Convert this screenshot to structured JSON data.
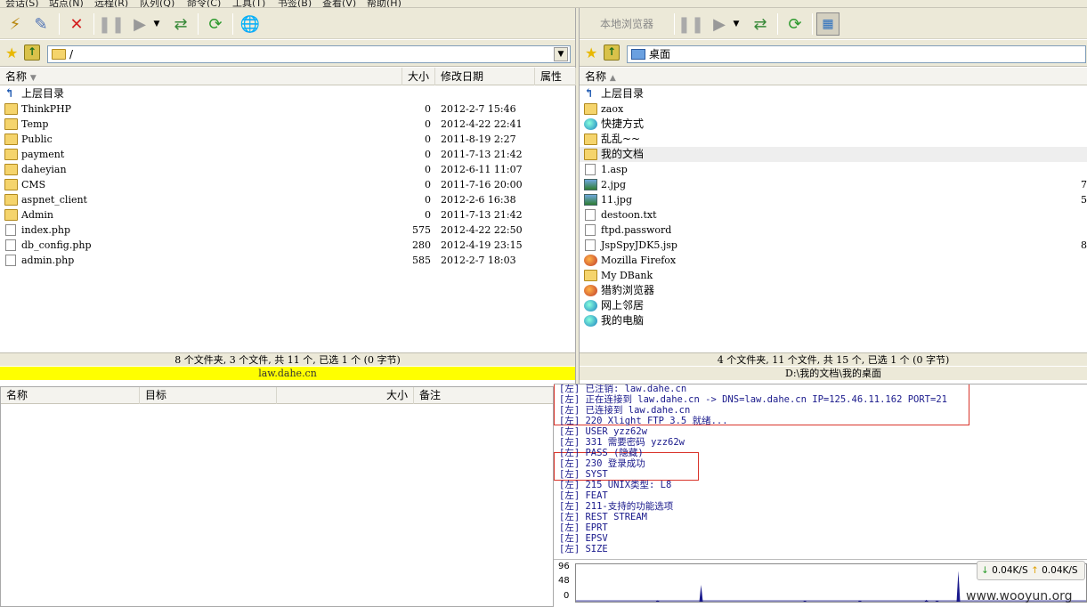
{
  "menu": {
    "items": [
      "会话(S)",
      "站点(N)",
      "远程(R)",
      "队列(Q)",
      "命令(C)",
      "工具(T)",
      "书签(B)",
      "查看(V)",
      "帮助(H)"
    ]
  },
  "left": {
    "address": "/",
    "columns": {
      "name": "名称",
      "size": "大小",
      "date": "修改日期",
      "attr": "属性"
    },
    "parent": "上层目录",
    "files": [
      {
        "name": "ThinkPHP",
        "size": "0",
        "date": "2012-2-7 15:46",
        "icon": "folder-icon"
      },
      {
        "name": "Temp",
        "size": "0",
        "date": "2012-4-22 22:41",
        "icon": "folder-icon"
      },
      {
        "name": "Public",
        "size": "0",
        "date": "2011-8-19 2:27",
        "icon": "folder-icon"
      },
      {
        "name": "payment",
        "size": "0",
        "date": "2011-7-13 21:42",
        "icon": "folder-icon"
      },
      {
        "name": "daheyian",
        "size": "0",
        "date": "2012-6-11 11:07",
        "icon": "folder-icon"
      },
      {
        "name": "CMS",
        "size": "0",
        "date": "2011-7-16 20:00",
        "icon": "folder-icon"
      },
      {
        "name": "aspnet_client",
        "size": "0",
        "date": "2012-2-6 16:38",
        "icon": "folder-icon"
      },
      {
        "name": "Admin",
        "size": "0",
        "date": "2011-7-13 21:42",
        "icon": "folder-icon"
      },
      {
        "name": "index.php",
        "size": "575",
        "date": "2012-4-22 22:50",
        "icon": "php-file-icon"
      },
      {
        "name": "db_config.php",
        "size": "280",
        "date": "2012-4-19 23:15",
        "icon": "php-file-icon"
      },
      {
        "name": "admin.php",
        "size": "585",
        "date": "2012-2-7 18:03",
        "icon": "php-file-icon"
      }
    ],
    "status": "8 个文件夹, 3 个文件, 共 11 个, 已选 1 个 (0 字节)",
    "host": "law.dahe.cn"
  },
  "right": {
    "browser_label": "本地浏览器",
    "address": "桌面",
    "columns": {
      "name": "名称"
    },
    "parent": "上层目录",
    "files": [
      {
        "name": "zaox",
        "icon": "folder-icon",
        "size": ""
      },
      {
        "name": "快捷方式",
        "icon": "web-icon",
        "size": ""
      },
      {
        "name": "乱乱~~",
        "icon": "folder-icon",
        "size": ""
      },
      {
        "name": "我的文档",
        "icon": "folder-icon",
        "size": ""
      },
      {
        "name": "1.asp",
        "icon": "file-icon",
        "size": ""
      },
      {
        "name": "2.jpg",
        "icon": "image-icon",
        "size": "7"
      },
      {
        "name": "11.jpg",
        "icon": "image-icon",
        "size": "5"
      },
      {
        "name": "destoon.txt",
        "icon": "text-file-icon",
        "size": ""
      },
      {
        "name": "ftpd.password",
        "icon": "file-icon",
        "size": ""
      },
      {
        "name": "JspSpyJDK5.jsp",
        "icon": "file-icon",
        "size": "8"
      },
      {
        "name": "Mozilla Firefox",
        "icon": "firefox-icon",
        "size": ""
      },
      {
        "name": "My DBank",
        "icon": "folder-icon",
        "size": ""
      },
      {
        "name": "猎豹浏览器",
        "icon": "browser-icon",
        "size": ""
      },
      {
        "name": "网上邻居",
        "icon": "network-icon",
        "size": ""
      },
      {
        "name": "我的电脑",
        "icon": "computer-icon",
        "size": ""
      }
    ],
    "status": "4 个文件夹, 11 个文件, 共 15 个, 已选 1 个 (0 字节)",
    "path": "D:\\我的文档\\我的桌面"
  },
  "queue": {
    "columns": {
      "name": "名称",
      "target": "目标",
      "size": "大小",
      "note": "备注"
    }
  },
  "log": [
    "[左] 已注销: law.dahe.cn",
    "[左] 正在连接到 law.dahe.cn -> DNS=law.dahe.cn IP=125.46.11.162 PORT=21",
    "[左] 已连接到 law.dahe.cn",
    "[左] 220 Xlight FTP 3.5 就绪...",
    "[左] USER yzz62w",
    "[左] 331 需要密码 yzz62w",
    "[左] PASS (隐藏)",
    "[左] 230 登录成功",
    "[左] SYST",
    "[左] 215 UNIX类型: L8",
    "[左] FEAT",
    "[左] 211-支持的功能选项",
    "[左]  REST STREAM",
    "[左]  EPRT",
    "[左]  EPSV",
    "[左]  SIZE"
  ],
  "graph": {
    "labels": [
      "96",
      "48",
      "0"
    ],
    "spikes": [
      0.04,
      0.45,
      0.02,
      0.03,
      0.05,
      0.03,
      0.82
    ]
  },
  "speed": {
    "down": "0.04K/S",
    "up": "0.04K/S"
  },
  "watermark": "www.wooyun.org",
  "colors": {
    "highlight": "#ffff00",
    "log_text": "#1a1a8c",
    "annotation": "#d9342b"
  }
}
